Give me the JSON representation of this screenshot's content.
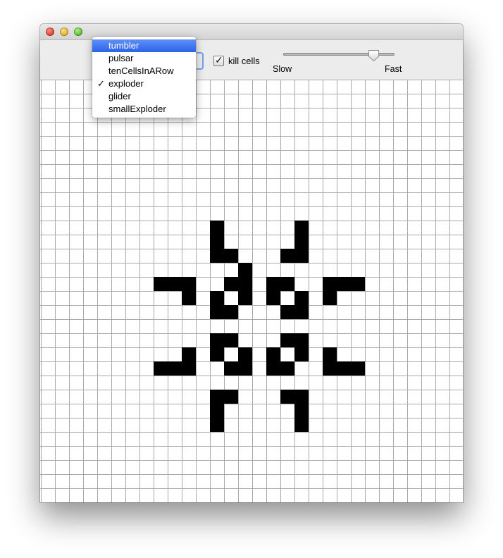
{
  "window": {
    "controls": [
      "close",
      "minimize",
      "zoom"
    ]
  },
  "pattern_menu": {
    "items": [
      {
        "label": "tumbler",
        "highlighted": true,
        "checked": false
      },
      {
        "label": "pulsar",
        "highlighted": false,
        "checked": false
      },
      {
        "label": "tenCellsInARow",
        "highlighted": false,
        "checked": false
      },
      {
        "label": "exploder",
        "highlighted": false,
        "checked": true
      },
      {
        "label": "glider",
        "highlighted": false,
        "checked": false
      },
      {
        "label": "smallExploder",
        "highlighted": false,
        "checked": false
      }
    ],
    "check_glyph": "✓"
  },
  "kill_cells": {
    "label": "kill cells",
    "checked": true,
    "check_glyph": "✓"
  },
  "speed": {
    "min_label": "Slow",
    "max_label": "Fast",
    "value": 0.85
  },
  "board": {
    "columns": 30,
    "rows": 30,
    "colors": {
      "alive": "#000000",
      "dead": "#ffffff",
      "grid": "#aaaaaa"
    },
    "live_cells": [
      [
        12,
        10
      ],
      [
        18,
        10
      ],
      [
        12,
        11
      ],
      [
        18,
        11
      ],
      [
        12,
        12
      ],
      [
        13,
        12
      ],
      [
        17,
        12
      ],
      [
        18,
        12
      ],
      [
        14,
        13
      ],
      [
        8,
        14
      ],
      [
        9,
        14
      ],
      [
        10,
        14
      ],
      [
        13,
        14
      ],
      [
        14,
        14
      ],
      [
        16,
        14
      ],
      [
        17,
        14
      ],
      [
        20,
        14
      ],
      [
        21,
        14
      ],
      [
        22,
        14
      ],
      [
        10,
        15
      ],
      [
        12,
        15
      ],
      [
        14,
        15
      ],
      [
        16,
        15
      ],
      [
        18,
        15
      ],
      [
        20,
        15
      ],
      [
        12,
        16
      ],
      [
        13,
        16
      ],
      [
        17,
        16
      ],
      [
        18,
        16
      ],
      [
        12,
        18
      ],
      [
        13,
        18
      ],
      [
        17,
        18
      ],
      [
        18,
        18
      ],
      [
        10,
        19
      ],
      [
        12,
        19
      ],
      [
        14,
        19
      ],
      [
        16,
        19
      ],
      [
        18,
        19
      ],
      [
        20,
        19
      ],
      [
        8,
        20
      ],
      [
        9,
        20
      ],
      [
        10,
        20
      ],
      [
        13,
        20
      ],
      [
        14,
        20
      ],
      [
        16,
        20
      ],
      [
        17,
        20
      ],
      [
        20,
        20
      ],
      [
        21,
        20
      ],
      [
        22,
        20
      ],
      [
        12,
        22
      ],
      [
        13,
        22
      ],
      [
        17,
        22
      ],
      [
        18,
        22
      ],
      [
        12,
        23
      ],
      [
        18,
        23
      ],
      [
        12,
        24
      ],
      [
        18,
        24
      ]
    ]
  }
}
